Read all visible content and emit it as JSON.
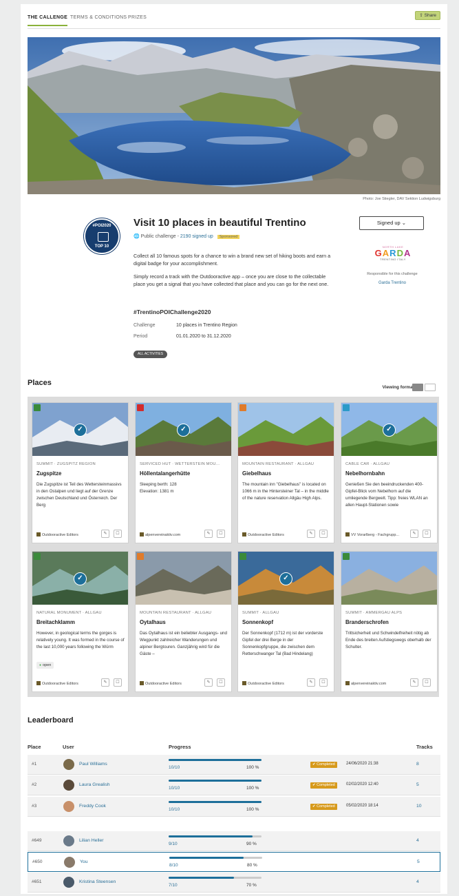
{
  "tabs": [
    "THE CALLENGE",
    "TERMS & CONDITIONS",
    "PRIZES"
  ],
  "share_label": "Share",
  "photo_credit": "Photo: Joe Stiegler, DAV Sektion Ludwigsburg",
  "badge": {
    "top": "#POI2020",
    "bottom": "TOP 10"
  },
  "challenge": {
    "title": "Visit 10 places in beautiful Trentino",
    "type": "Public challenge",
    "separator": " - ",
    "signed_up": "2190 signed up",
    "sponsored": "Sponsored",
    "desc1": "Collect all 10 famous spots for a chance to win a brand new set of hiking boots and earn a digital badge for your accomplishment.",
    "desc2": "Simply record a track with the Outdooractive app – once you are close to the collectable place you get a signal that you have collected that place and you can go for the next one.",
    "hashtag": "#TrentinoPOIChallenge2020",
    "challenge_label": "Challenge",
    "challenge_value": "10 places in Trentino Region",
    "period_label": "Period",
    "period_value": "01.01.2020 to 31.12.2020",
    "all_activities": "ALL ACTIVITIES",
    "signed_up_button": "Signed up ⌄"
  },
  "sponsor": {
    "logo_top": "NORTH LAKE",
    "logo_main": "GARDA",
    "logo_bottom": "TRENTINO ITALY",
    "responsible": "Responsible for this challenge",
    "name": "Garda Trentino"
  },
  "places": {
    "title": "Places",
    "viewing_format": "Viewing format",
    "items": [
      {
        "category": "SUMMIT · ZUGSPITZ REGION",
        "name": "Zugspitze",
        "text": "Die Zugspitze ist Teil des Wettersteinmassivs in den Ostalpen und liegt auf der Grenze zwischen Deutschland und Österreich. Der Berg",
        "author": "Outdooractive Editors",
        "checked": true,
        "icon_color": "#3a8a3a",
        "icon": "summit-icon",
        "open": ""
      },
      {
        "category": "SERVICED HUT · WETTERSTEIN MOU...",
        "name": "Höllentalangerhütte",
        "text": "Sleeping berth: 128\nElevation: 1381 m",
        "author": "alpenvereinaktiv.com",
        "checked": true,
        "icon_color": "#d22c2c",
        "icon": "hut-icon",
        "open": ""
      },
      {
        "category": "MOUNTAIN RESTAURANT · ALLGÄU",
        "name": "Giebelhaus",
        "text": "The mountain inn \"Giebelhaus\" is located on 1066 m in the Hintersteiner Tal – in the middle of the nature reservation Allgäu High Alps.",
        "author": "Outdooractive Editors",
        "checked": false,
        "icon_color": "#e07b2a",
        "icon": "restaurant-icon",
        "open": ""
      },
      {
        "category": "CABLE CAR · ALLGÄU",
        "name": "Nebelhornbahn",
        "text": "Genießen Sie den beeindruckenden 400-Gipfel-Blick vom Nebelhorn auf die umliegende Bergwelt. Tipp: freies WLAN an allen Haupt-Stationen sowie",
        "author": "VV Vorarlberg - Fachgrupp...",
        "checked": true,
        "icon_color": "#2a9ac8",
        "icon": "cable-car-icon",
        "open": ""
      },
      {
        "category": "NATURAL MONUMENT · ALLGÄU",
        "name": "Breitachklamm",
        "text": "However, in geological terms the gorges is relatively young. It was formed in the course of the last 10,000 years following the Würm",
        "author": "Outdooractive Editors",
        "checked": true,
        "icon_color": "#3a8a3a",
        "icon": "monument-icon",
        "open": "open"
      },
      {
        "category": "MOUNTAIN RESTAURANT · ALLGÄU",
        "name": "Oytalhaus",
        "text": "Das Oytalhaus ist ein beliebter Ausgangs- und Wegpunkt zahlreicher Wanderungen und alpiner Bergtouren. Ganzjährig wird für die Gäste –",
        "author": "Outdooractive Editors",
        "checked": false,
        "icon_color": "#e07b2a",
        "icon": "restaurant-icon",
        "open": ""
      },
      {
        "category": "SUMMIT · ALLGÄU",
        "name": "Sonnenkopf",
        "text": "Der Sonnenkopf (1712 m) ist der vorderste Gipfel der drei Berge in der Sonnenkopfgruppe, die zwischen dem Retterschwanger Tal (Bad Hindelang)",
        "author": "Outdooractive Editors",
        "checked": true,
        "icon_color": "#3a8a3a",
        "icon": "summit-icon",
        "open": ""
      },
      {
        "category": "SUMMIT · AMMERGAU ALPS",
        "name": "Branderschrofen",
        "text": "Trittsicherheit und Schwindelfreiheit nötig ab Ende des breiten Aufstiegswegs oberhalb der Schulter.",
        "author": "alpenvereinaktiv.com",
        "checked": false,
        "icon_color": "#3a8a3a",
        "icon": "summit-icon",
        "open": ""
      }
    ]
  },
  "leaderboard": {
    "title": "Leaderboard",
    "headers": {
      "place": "Place",
      "user": "User",
      "progress": "Progress",
      "tracks": "Tracks"
    },
    "rows": [
      {
        "place": "#1",
        "user": "Paul Williams",
        "count": "10/10",
        "pct": "100 %",
        "progress": 1.0,
        "completed": "✔ Completed",
        "date": "24/06/2020 21:38",
        "tracks": "8",
        "you": false
      },
      {
        "place": "#2",
        "user": "Laura Grealish",
        "count": "10/10",
        "pct": "100 %",
        "progress": 1.0,
        "completed": "✔ Completed",
        "date": "02/02/2020 12:40",
        "tracks": "5",
        "you": false
      },
      {
        "place": "#3",
        "user": "Freddy Cook",
        "count": "10/10",
        "pct": "100 %",
        "progress": 1.0,
        "completed": "✔ Completed",
        "date": "05/02/2020 18:14",
        "tracks": "10",
        "you": false
      },
      {
        "place": "#649",
        "user": "Lilian Heller",
        "count": "9/10",
        "pct": "90 %",
        "progress": 0.9,
        "completed": "",
        "date": "",
        "tracks": "4",
        "you": false
      },
      {
        "place": "#650",
        "user": "You",
        "count": "8/10",
        "pct": "80 %",
        "progress": 0.8,
        "completed": "",
        "date": "",
        "tracks": "5",
        "you": true
      },
      {
        "place": "#651",
        "user": "Kristina Steensen",
        "count": "7/10",
        "pct": "70 %",
        "progress": 0.7,
        "completed": "",
        "date": "",
        "tracks": "4",
        "you": false
      }
    ]
  }
}
